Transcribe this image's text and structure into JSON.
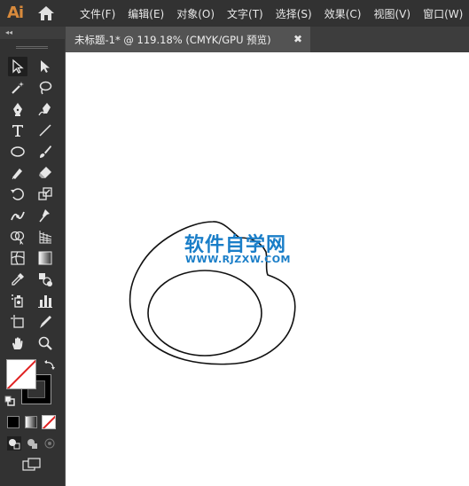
{
  "app": {
    "logo": "Ai"
  },
  "menu": [
    {
      "label": "文件(F)"
    },
    {
      "label": "编辑(E)"
    },
    {
      "label": "对象(O)"
    },
    {
      "label": "文字(T)"
    },
    {
      "label": "选择(S)"
    },
    {
      "label": "效果(C)"
    },
    {
      "label": "视图(V)"
    },
    {
      "label": "窗口(W)"
    }
  ],
  "document_tab": {
    "title": "未标题-1* @ 119.18% (CMYK/GPU 预览)",
    "close": "✖"
  },
  "toolbar_collapse": "◂◂",
  "canvas": {
    "watermark_title": "软件自学网",
    "watermark_url": "WWW.RJZXW.COM"
  },
  "colors": {
    "accent": "#d88a3c",
    "watermark": "#1a7ec8",
    "panel": "#323232",
    "workspace": "#535353"
  }
}
